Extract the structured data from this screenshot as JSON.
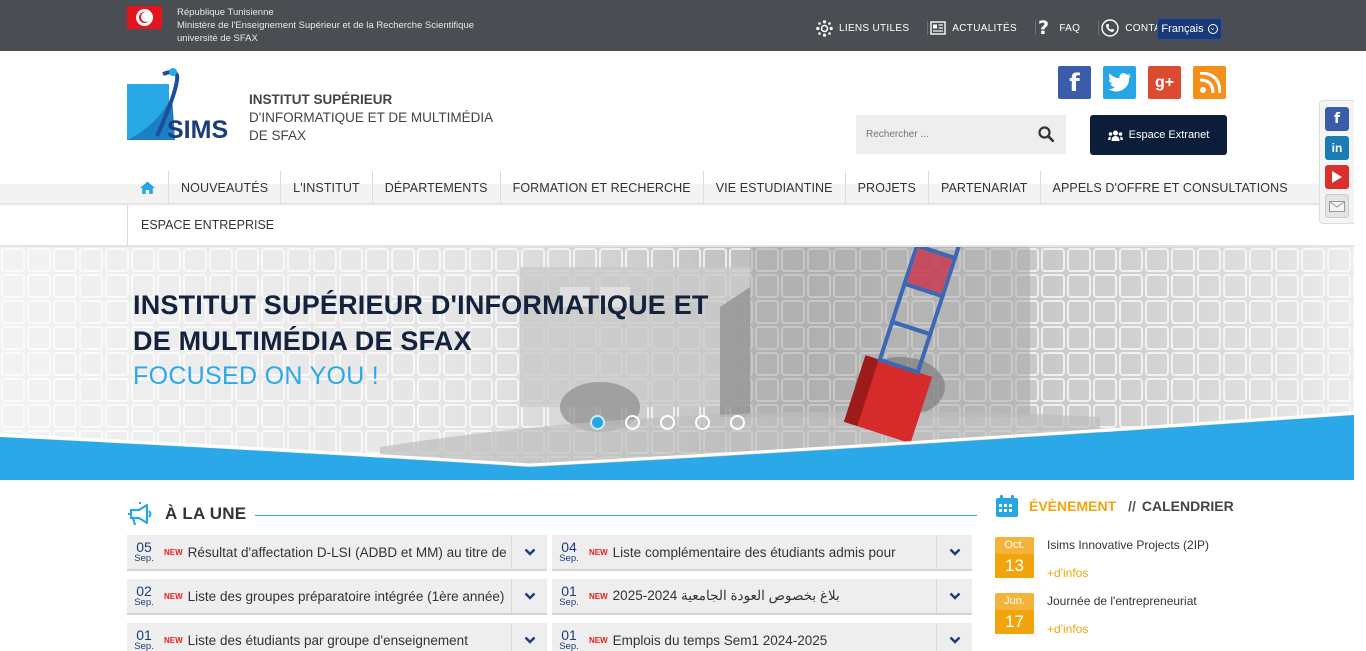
{
  "topbar": {
    "gov_lines": [
      "République Tunisienne",
      "Ministère de l'Enseignement Supérieur et de la Recherche Scientifique",
      "université de SFAX"
    ],
    "links": [
      {
        "label": "LIENS UTILES",
        "icon": "network-icon"
      },
      {
        "label": "ACTUALITÉS",
        "icon": "newspaper-icon"
      },
      {
        "label": "FAQ",
        "icon": "question-icon"
      },
      {
        "label": "CONTACT",
        "icon": "phone-icon"
      }
    ],
    "language": "Français"
  },
  "header": {
    "institute_line1": "INSTITUT SUPÉRIEUR",
    "institute_line2": "D'INFORMATIQUE ET DE MULTIMÉDIA",
    "institute_line3": "DE SFAX",
    "logo_text": "SIMS",
    "search_placeholder": "Rechercher ...",
    "extranet_label": "Espace Extranet"
  },
  "nav": {
    "items": [
      "NOUVEAUTÉS",
      "L'INSTITUT",
      "DÉPARTEMENTS",
      "FORMATION ET RECHERCHE",
      "VIE ESTUDIANTINE",
      "PROJETS",
      "PARTENARIAT",
      "APPELS D'OFFRE ET CONSULTATIONS"
    ],
    "second_row": "ESPACE ENTREPRISE"
  },
  "hero": {
    "title_line1": "INSTITUT SUPÉRIEUR D'INFORMATIQUE ET",
    "title_line2": "DE MULTIMÉDIA DE SFAX",
    "subtitle": "FOCUSED ON YOU !",
    "slides": 5,
    "active_slide": 1
  },
  "news": {
    "title": "À LA UNE",
    "badge": "NEW",
    "items": [
      {
        "day": "05",
        "month": "Sep.",
        "text": "Résultat d'affectation D-LSI (ADBD et MM) au titre de"
      },
      {
        "day": "04",
        "month": "Sep.",
        "text": "Liste complémentaire des étudiants admis pour"
      },
      {
        "day": "02",
        "month": "Sep.",
        "text": "Liste des groupes préparatoire intégrée (1ère année)"
      },
      {
        "day": "01",
        "month": "Sep.",
        "text": "2025-2024 بلاغ بخصوص العودة الجامعية"
      },
      {
        "day": "01",
        "month": "Sep.",
        "text": "Liste des étudiants par groupe d'enseignement"
      },
      {
        "day": "01",
        "month": "Sep.",
        "text": "Emplois du temps Sem1 2024-2025"
      }
    ]
  },
  "events": {
    "title": "ÉVÈNEMENT",
    "separator": "//",
    "title2": "CALENDRIER",
    "more_label": "+d'infos",
    "items": [
      {
        "month": "Oct.",
        "day": "13",
        "name": "Isims Innovative Projects (2IP)"
      },
      {
        "month": "Jun.",
        "day": "17",
        "name": "Journée de l'entrepreneuriat"
      }
    ]
  },
  "colors": {
    "topbar": "#4a4d51",
    "accent_blue": "#27a6e6",
    "navy": "#0c1d3a",
    "event_orange": "#f1a40d",
    "new_red": "#e2201b"
  }
}
